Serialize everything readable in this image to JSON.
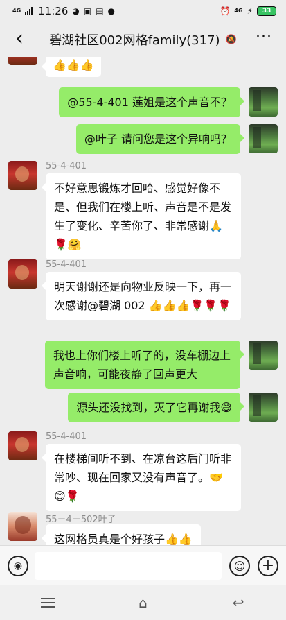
{
  "status_bar": {
    "network": "4G",
    "time": "11:26",
    "right_network": "4G",
    "battery": "33"
  },
  "header": {
    "back_icon": "back-chevron-icon",
    "title": "碧湖社区002网格family(317)",
    "mute_icon": "bell-off-icon",
    "more_label": "···"
  },
  "messages": [
    {
      "side": "left",
      "sender": "",
      "text": "👍👍👍"
    },
    {
      "side": "right",
      "sender": "",
      "text": "@55-4-401  莲姐是这个声音不？"
    },
    {
      "side": "right",
      "sender": "",
      "text": "@叶子  请问您是这个异响吗？"
    },
    {
      "side": "left",
      "sender": "55-4-401",
      "text": "不好意思锻炼才回哈、感觉好像不是、但我们在楼上听、声音是不是发生了变化、辛苦你了、非常感谢🙏🌹🤗"
    },
    {
      "side": "left",
      "sender": "55-4-401",
      "text": "明天谢谢还是向物业反映一下，再一次感谢@碧湖 002 👍👍👍🌹🌹🌹"
    },
    {
      "side": "right",
      "sender": "",
      "text": "我也上你们楼上听了的，没车棚边上声音响，可能夜静了回声更大"
    },
    {
      "side": "right",
      "sender": "",
      "text": "源头还没找到，灭了它再谢我😅"
    },
    {
      "side": "left",
      "sender": "55-4-401",
      "text": "在楼梯间听不到、在凉台这后门听非常吵、现在回家又没有声音了。🤝😊🌹"
    },
    {
      "side": "left",
      "sender": "55－4－502叶子",
      "text": "这网格员真是个好孩子👍👍"
    }
  ],
  "input_bar": {
    "voice_icon": "voice-icon",
    "placeholder": "",
    "emoji_icon": "emoji-icon",
    "plus_icon": "plus-icon"
  },
  "nav_bar": {
    "menu_icon": "menu-icon",
    "home_icon": "home-icon",
    "back_icon": "back-icon"
  }
}
